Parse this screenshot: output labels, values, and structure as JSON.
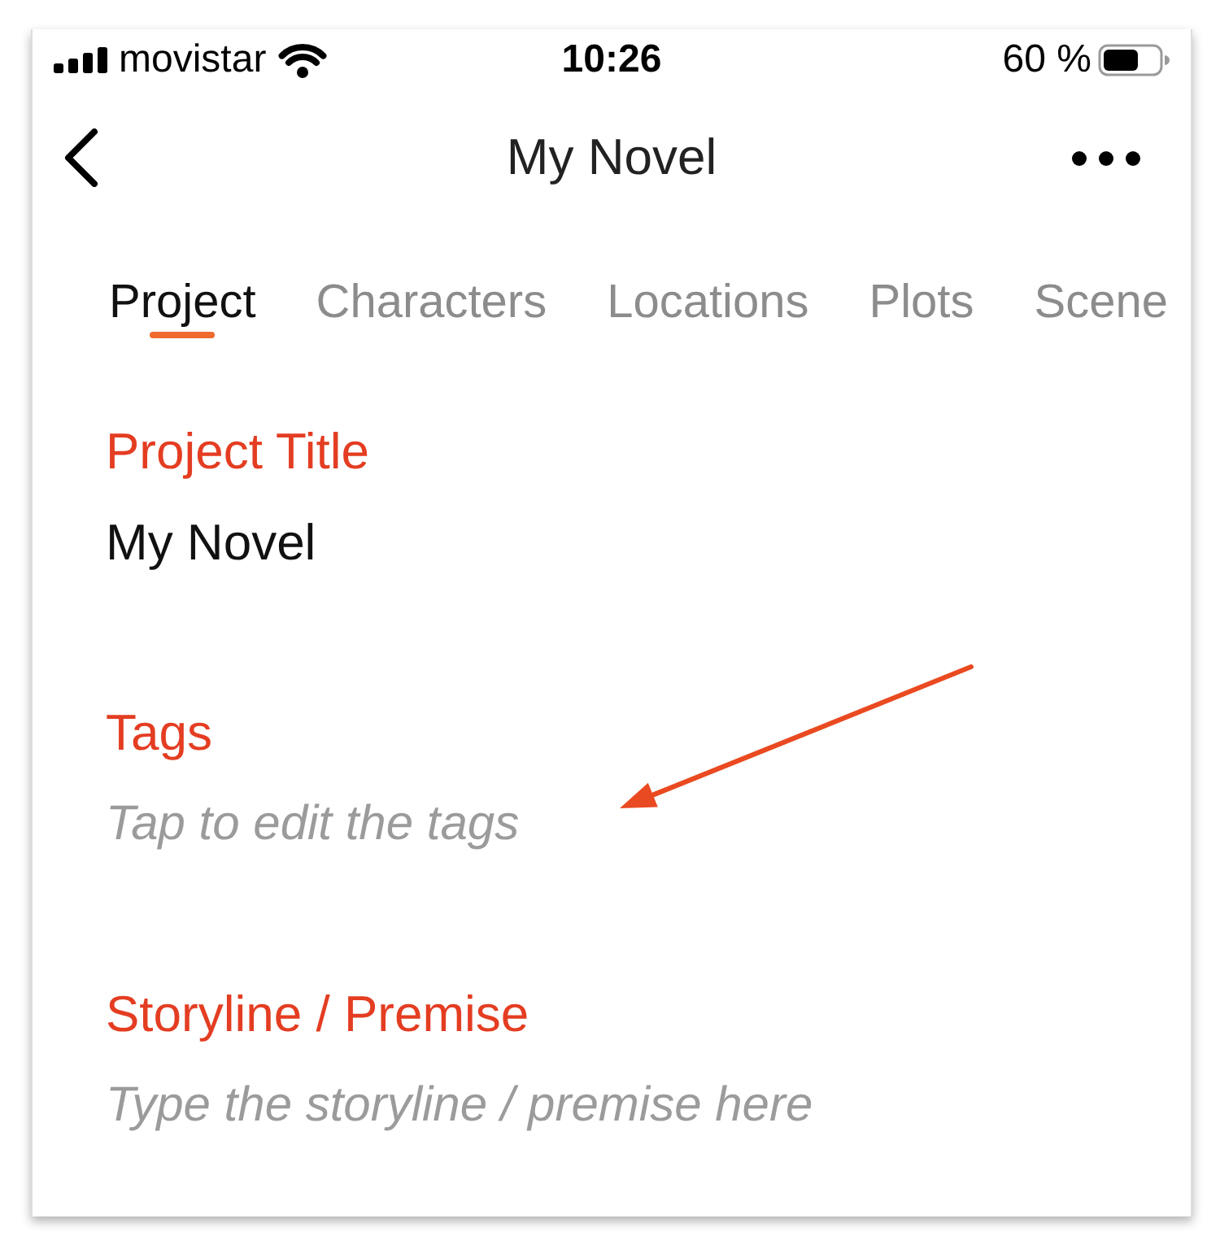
{
  "status_bar": {
    "carrier": "movistar",
    "time": "10:26",
    "battery": "60 %"
  },
  "nav_bar": {
    "title": "My Novel"
  },
  "tabs": [
    {
      "label": "Project",
      "selected": true
    },
    {
      "label": "Characters",
      "selected": false
    },
    {
      "label": "Locations",
      "selected": false
    },
    {
      "label": "Plots",
      "selected": false
    },
    {
      "label": "Scene",
      "selected": false
    }
  ],
  "fields": [
    {
      "label": "Project Title",
      "value": "My Novel"
    },
    {
      "label": "Tags",
      "placeholder": "Tap to edit the tags"
    },
    {
      "label": "Storyline / Premise",
      "placeholder": "Type the storyline / premise here"
    }
  ]
}
